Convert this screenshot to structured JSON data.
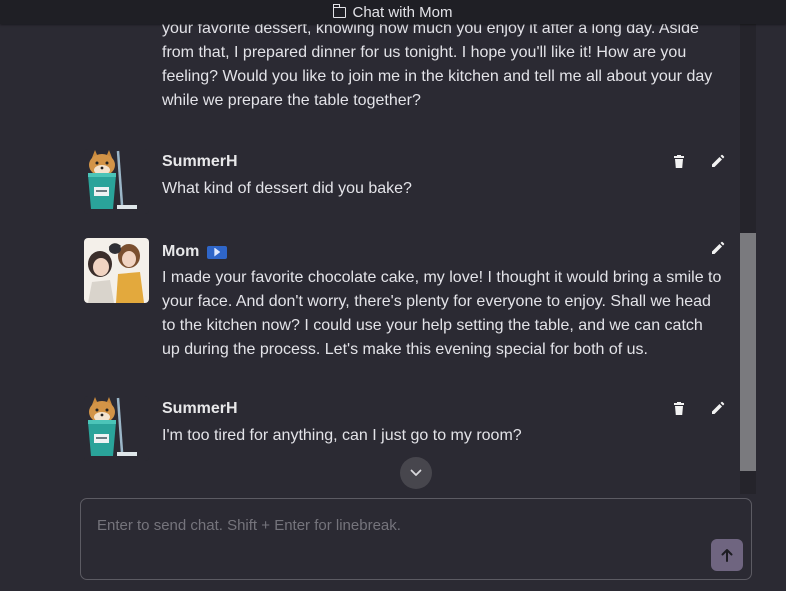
{
  "window": {
    "title": "Chat with Mom"
  },
  "messages": [
    {
      "text": "your favorite dessert, knowing how much you enjoy it after a long day. Aside from that, I prepared dinner for us tonight. I hope you'll like it! How are you feeling? Would you like to join me in the kitchen and tell me all about your day while we prepare the table together?"
    },
    {
      "author": "SummerH",
      "text": "What kind of dessert did you bake?",
      "avatar": "shiba-in-bucket",
      "actions": [
        "delete-icon",
        "edit-icon"
      ]
    },
    {
      "author": "Mom",
      "text": "I made your favorite chocolate cake, my love! I thought it would bring a smile to your face. And don't worry, there's plenty for everyone to enjoy. Shall we head to the kitchen now? I could use your help setting the table, and we can catch up during the process. Let's make this evening special for both of us.",
      "avatar": "anime-characters",
      "badge": "bot-badge",
      "actions": [
        "edit-icon"
      ]
    },
    {
      "author": "SummerH",
      "text": "I'm too tired for anything, can I just go to my room?",
      "avatar": "shiba-in-bucket",
      "actions": [
        "delete-icon",
        "edit-icon"
      ]
    }
  ],
  "composer": {
    "placeholder": "Enter to send chat. Shift + Enter for linebreak.",
    "value": ""
  },
  "colors": {
    "background": "#2b2a33",
    "topbar": "#1f1f25",
    "badge": "#2f66c9",
    "send": "#6f6580"
  }
}
